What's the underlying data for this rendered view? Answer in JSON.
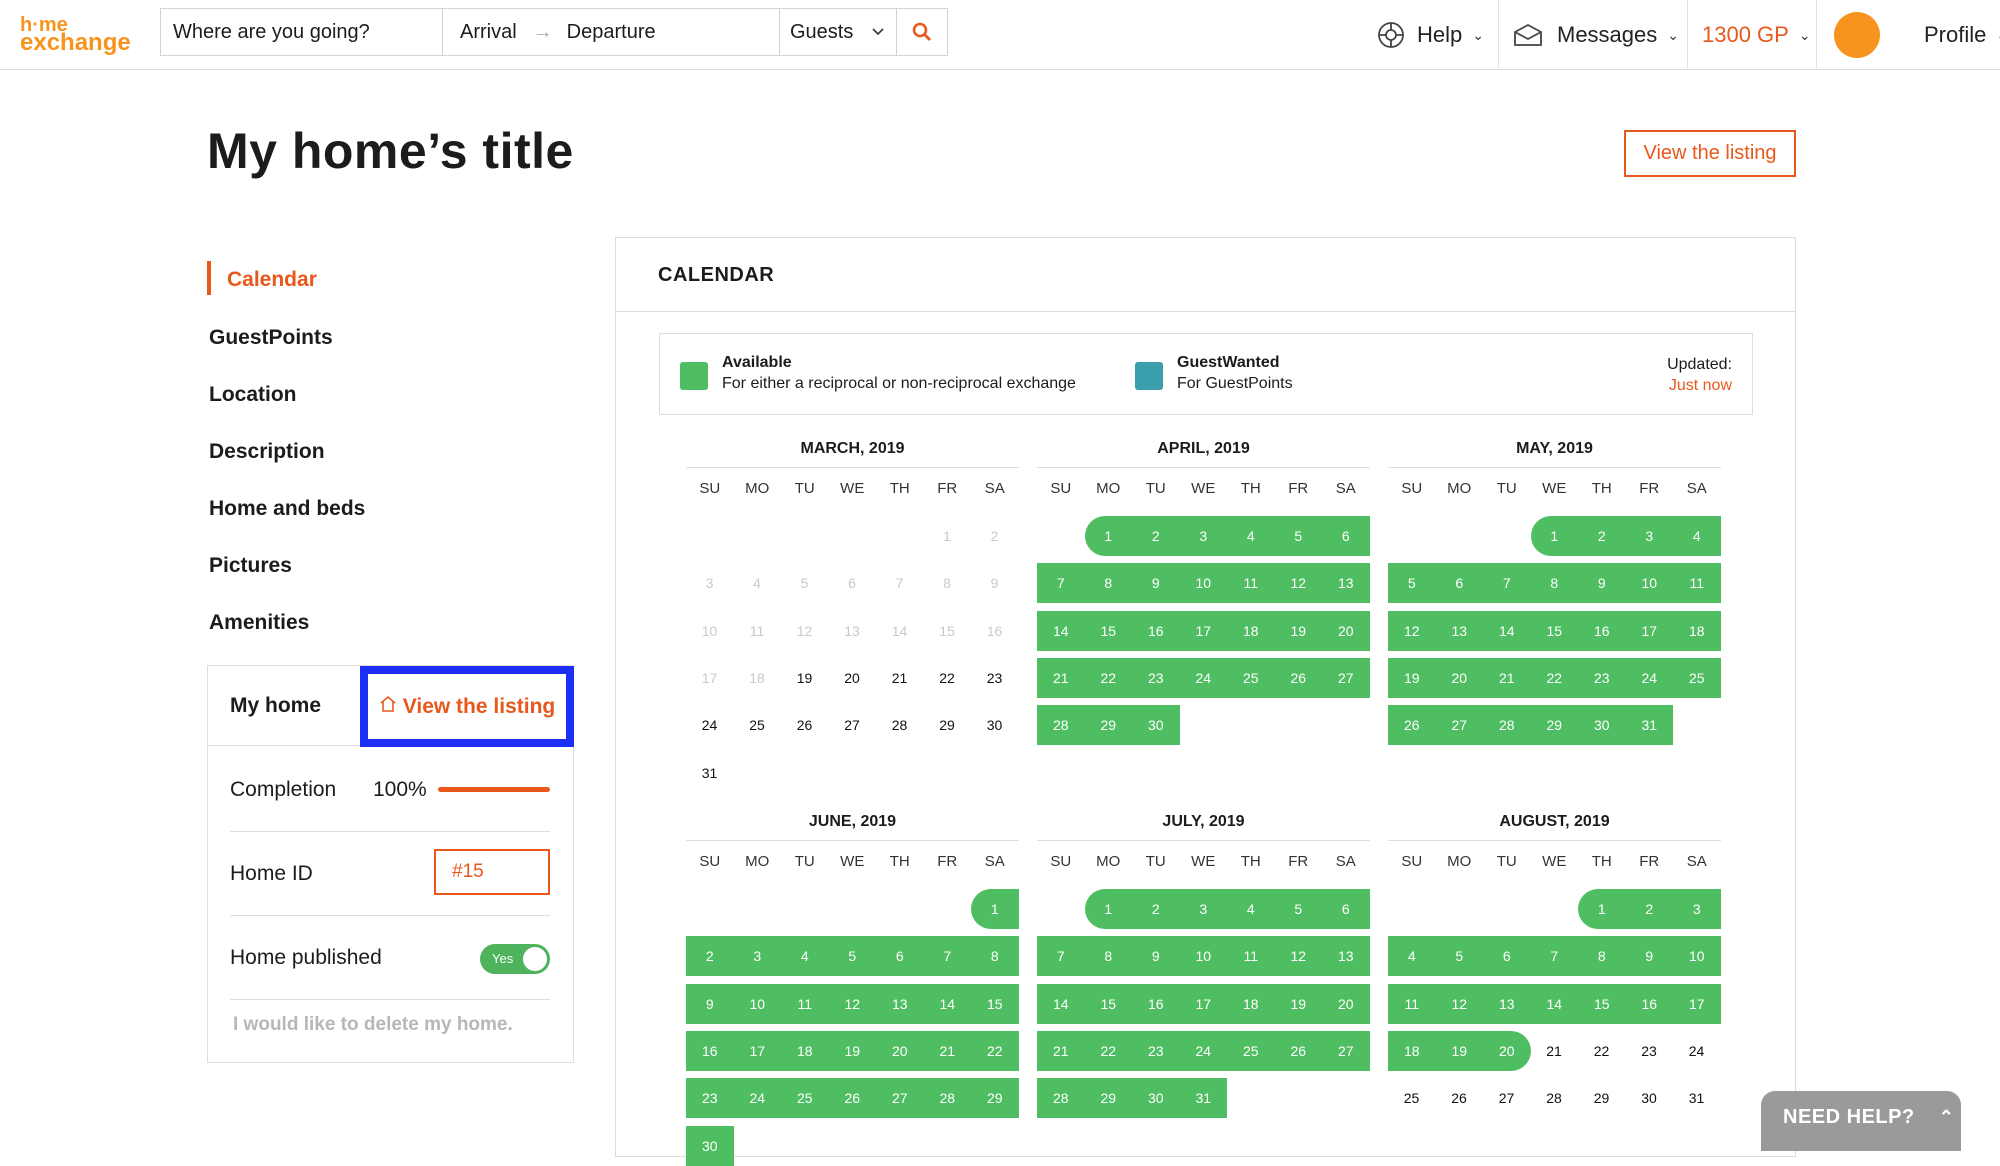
{
  "colors": {
    "accent": "#e8581c",
    "logo": "#f7941d",
    "available": "#4fbe62",
    "guestwanted": "#3b9ead",
    "highlight": "#1e2ff5"
  },
  "header": {
    "logo_line1": "h·me",
    "logo_line2": "exchange",
    "search": {
      "destination": "Where are you going?",
      "arrival": "Arrival",
      "arrow": "→",
      "departure": "Departure",
      "guests": "Guests"
    },
    "help": "Help",
    "messages": "Messages",
    "points": "1300 GP",
    "profile": "Profile"
  },
  "page": {
    "title": "My home’s title",
    "view_listing": "View the listing"
  },
  "sidebar": {
    "items": [
      "Calendar",
      "GuestPoints",
      "Location",
      "Description",
      "Home and beds",
      "Pictures",
      "Amenities"
    ],
    "active": 0
  },
  "card": {
    "title": "My home",
    "view_listing": "View the listing",
    "completion_label": "Completion",
    "completion_value": "100%",
    "completion": 1.0,
    "home_id_label": "Home ID",
    "home_id": "#15",
    "published_label": "Home published",
    "published_toggle": "Yes",
    "delete_text": "I would like to delete my home."
  },
  "calendar": {
    "title": "CALENDAR",
    "legend": {
      "available_title": "Available",
      "available_desc": "For either a reciprocal or non-reciprocal exchange",
      "guestwanted_title": "GuestWanted",
      "guestwanted_desc": "For GuestPoints",
      "updated_label": "Updated:",
      "updated_value": "Just now"
    },
    "weekdays": [
      "SU",
      "MO",
      "TU",
      "WE",
      "TH",
      "FR",
      "SA"
    ],
    "months": [
      {
        "name": "MARCH, 2019",
        "start": 5,
        "days": 31,
        "available": [],
        "muted_until": 19
      },
      {
        "name": "APRIL, 2019",
        "start": 1,
        "days": 30,
        "available": [
          1,
          2,
          3,
          4,
          5,
          6,
          7,
          8,
          9,
          10,
          11,
          12,
          13,
          14,
          15,
          16,
          17,
          18,
          19,
          20,
          21,
          22,
          23,
          24,
          25,
          26,
          27,
          28,
          29,
          30
        ],
        "muted_until": 0
      },
      {
        "name": "MAY, 2019",
        "start": 3,
        "days": 31,
        "available": [
          1,
          2,
          3,
          4,
          5,
          6,
          7,
          8,
          9,
          10,
          11,
          12,
          13,
          14,
          15,
          16,
          17,
          18,
          19,
          20,
          21,
          22,
          23,
          24,
          25,
          26,
          27,
          28,
          29,
          30,
          31
        ],
        "muted_until": 0
      },
      {
        "name": "JUNE, 2019",
        "start": 6,
        "days": 30,
        "available": [
          1,
          2,
          3,
          4,
          5,
          6,
          7,
          8,
          9,
          10,
          11,
          12,
          13,
          14,
          15,
          16,
          17,
          18,
          19,
          20,
          21,
          22,
          23,
          24,
          25,
          26,
          27,
          28,
          29,
          30
        ],
        "muted_until": 0
      },
      {
        "name": "JULY, 2019",
        "start": 1,
        "days": 31,
        "available": [
          1,
          2,
          3,
          4,
          5,
          6,
          7,
          8,
          9,
          10,
          11,
          12,
          13,
          14,
          15,
          16,
          17,
          18,
          19,
          20,
          21,
          22,
          23,
          24,
          25,
          26,
          27,
          28,
          29,
          30,
          31
        ],
        "muted_until": 0
      },
      {
        "name": "AUGUST, 2019",
        "start": 4,
        "days": 31,
        "available": [
          1,
          2,
          3,
          4,
          5,
          6,
          7,
          8,
          9,
          10,
          11,
          12,
          13,
          14,
          15,
          16,
          17,
          18,
          19,
          20
        ],
        "muted_until": 0
      }
    ]
  },
  "help_widget": {
    "label": "NEED HELP?",
    "icon": "chevron-up-icon"
  }
}
